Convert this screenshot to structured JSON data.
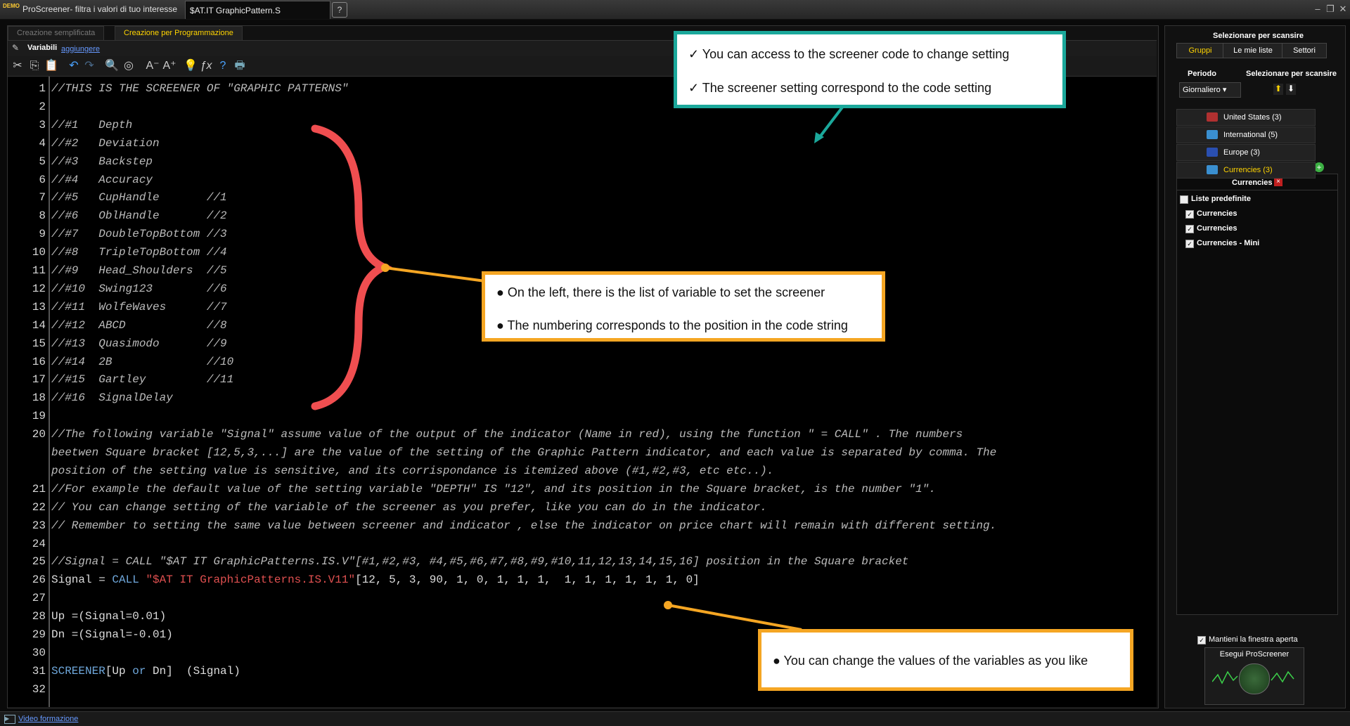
{
  "window": {
    "logo_text": "DEMO",
    "title": "ProScreener- filtra i valori di tuo interesse",
    "file_tab": "$AT.IT GraphicPattern.S",
    "help": "?"
  },
  "mode_tabs": {
    "simple": "Creazione semplificata",
    "programming": "Creazione per Programmazione"
  },
  "variables_bar": {
    "label": "Variabili",
    "add": "aggiungere"
  },
  "toolbar_icons": [
    "scissors-icon",
    "copy-icon",
    "paste-icon",
    "undo-icon",
    "redo-icon",
    "search-icon",
    "replace-icon",
    "font-decrease-icon",
    "font-increase-icon",
    "lightbulb-icon",
    "function-icon",
    "help-icon",
    "print-icon"
  ],
  "code_lines": [
    {
      "n": "1",
      "t": "//THIS IS THE SCREENER OF \"GRAPHIC PATTERNS\""
    },
    {
      "n": "2",
      "t": ""
    },
    {
      "n": "3",
      "t": "//#1   Depth"
    },
    {
      "n": "4",
      "t": "//#2   Deviation"
    },
    {
      "n": "5",
      "t": "//#3   Backstep"
    },
    {
      "n": "6",
      "t": "//#4   Accuracy"
    },
    {
      "n": "7",
      "t": "//#5   CupHandle       //1"
    },
    {
      "n": "8",
      "t": "//#6   OblHandle       //2"
    },
    {
      "n": "9",
      "t": "//#7   DoubleTopBottom //3"
    },
    {
      "n": "10",
      "t": "//#8   TripleTopBottom //4"
    },
    {
      "n": "11",
      "t": "//#9   Head_Shoulders  //5"
    },
    {
      "n": "12",
      "t": "//#10  Swing123        //6"
    },
    {
      "n": "13",
      "t": "//#11  WolfeWaves      //7"
    },
    {
      "n": "14",
      "t": "//#12  ABCD            //8"
    },
    {
      "n": "15",
      "t": "//#13  Quasimodo       //9"
    },
    {
      "n": "16",
      "t": "//#14  2B              //10"
    },
    {
      "n": "17",
      "t": "//#15  Gartley         //11"
    },
    {
      "n": "18",
      "t": "//#16  SignalDelay"
    },
    {
      "n": "19",
      "t": ""
    },
    {
      "n": "20",
      "t": "//The following variable \"Signal\" assume value of the output of the indicator (Name in red), using the function \" = CALL\" . The numbers"
    },
    {
      "n": "",
      "t": "beetwen Square bracket [12,5,3,...] are the value of the setting of the Graphic Pattern indicator, and each value is separated by comma. The"
    },
    {
      "n": "",
      "t": "position of the setting value is sensitive, and its corrispondance is itemized above (#1,#2,#3, etc etc..)."
    },
    {
      "n": "21",
      "t": "//For example the default value of the setting variable \"DEPTH\" IS \"12\", and its position in the Square bracket, is the number \"1\"."
    },
    {
      "n": "22",
      "t": "// You can change setting of the variable of the screener as you prefer, like you can do in the indicator."
    },
    {
      "n": "23",
      "t": "// Remember to setting the same value between screener and indicator , else the indicator on price chart will remain with different setting."
    },
    {
      "n": "24",
      "t": ""
    },
    {
      "n": "25",
      "t": "//Signal = CALL \"$AT IT GraphicPatterns.IS.V\"[#1,#2,#3, #4,#5,#6,#7,#8,#9,#10,11,12,13,14,15,16] position in the Square bracket"
    }
  ],
  "code_signal": {
    "n": "26",
    "a": "Signal = ",
    "kw": "CALL",
    "sp": " ",
    "str": "\"$AT IT GraphicPatterns.IS.V11\"",
    "rest": "[12, 5, 3, 90, 1, 0, 1, 1, 1,  1, 1, 1, 1, 1, 1, 0]"
  },
  "code_tail": [
    {
      "n": "27",
      "t": ""
    },
    {
      "n": "28",
      "t": "Up =(Signal=0.01)"
    },
    {
      "n": "29",
      "t": "Dn =(Signal=-0.01)"
    },
    {
      "n": "30",
      "t": ""
    }
  ],
  "code_screener": {
    "n": "31",
    "kw": "SCREENER",
    "a": "[Up ",
    "or": "or",
    "b": " Dn]  (Signal)"
  },
  "code_last": {
    "n": "32",
    "t": ""
  },
  "right_panel": {
    "header": "Selezionare per scansire",
    "tabs": [
      "Gruppi",
      "Le mie liste",
      "Settori"
    ],
    "period_label": "Periodo",
    "scan_label": "Selezionare per scansire",
    "period_value": "Giornaliero",
    "groups": [
      {
        "label": "United States (3)",
        "color": "#b03030"
      },
      {
        "label": "International (5)",
        "color": "#3a8fd0"
      },
      {
        "label": "Europe (3)",
        "color": "#2a4fb0"
      },
      {
        "label": "Currencies (3)",
        "color": "#3a8fd0",
        "active": true
      }
    ],
    "list_title": "Currencies",
    "list_items": [
      {
        "label": "Liste predefinite",
        "checked": false
      },
      {
        "label": "Currencies",
        "checked": true
      },
      {
        "label": "Currencies",
        "checked": true
      },
      {
        "label": "Currencies - Mini",
        "checked": true
      }
    ],
    "keep_open": "Mantieni la finestra aperta",
    "run": "Esegui ProScreener"
  },
  "status_bar": {
    "link": "Video formazione"
  },
  "annotations": {
    "top": [
      "✓ You can access to the screener code to change setting",
      "✓ The screener setting correspond to the code setting"
    ],
    "middle": [
      "● On the left, there is the list of variable to set the screener",
      "● The numbering corresponds to the position in the code string"
    ],
    "bottom": [
      "● You can change the values of the variables as you like"
    ]
  },
  "colors": {
    "accent_yellow": "#ffd400",
    "callout_teal": "#1ba89b",
    "callout_orange": "#f5a623",
    "brace_red": "#f04e50"
  }
}
